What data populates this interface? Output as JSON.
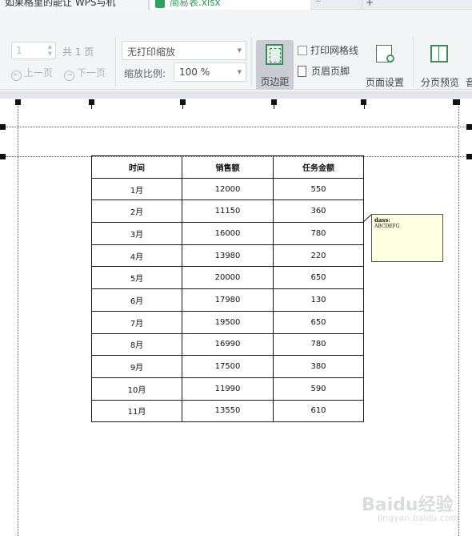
{
  "tabs": {
    "doc_tab_label": "如果格里的能让 WPS与机",
    "file_tab_label": "简易表.xlsx",
    "add_tab_label": "+"
  },
  "toolbar": {
    "page_number_value": "1",
    "total_pages": "共 1 页",
    "prev_page": "上一页",
    "next_page": "下一页",
    "scale_mode": "无打印缩放",
    "scale_label": "缩放比例:",
    "scale_ratio": "100 %",
    "margins_label": "页边距",
    "print_gridlines_label": "打印网格线",
    "print_gridlines_checked": false,
    "header_footer_label": "页眉页脚",
    "page_setup_label": "页面设置",
    "page_break_preview_label": "分页预览",
    "cut_label": "音"
  },
  "sheet": {
    "headers": [
      "时间",
      "销售额",
      "任务金额"
    ],
    "rows": [
      [
        "1月",
        "12000",
        "550"
      ],
      [
        "2月",
        "11150",
        "360"
      ],
      [
        "3月",
        "16000",
        "780"
      ],
      [
        "4月",
        "13980",
        "220"
      ],
      [
        "5月",
        "20000",
        "650"
      ],
      [
        "6月",
        "17980",
        "130"
      ],
      [
        "7月",
        "19500",
        "650"
      ],
      [
        "8月",
        "16990",
        "780"
      ],
      [
        "9月",
        "17500",
        "380"
      ],
      [
        "10月",
        "11990",
        "590"
      ],
      [
        "11月",
        "13550",
        "610"
      ]
    ]
  },
  "comment": {
    "author": "dass:",
    "text": "ABCDEFG",
    "background": "#ffffe1"
  },
  "watermark": {
    "brand": "Baidu经验",
    "sub": "jingyan.baidu.com"
  },
  "colors": {
    "accent_green": "#3d8a58",
    "active_button_bg": "#c9cdd3"
  }
}
